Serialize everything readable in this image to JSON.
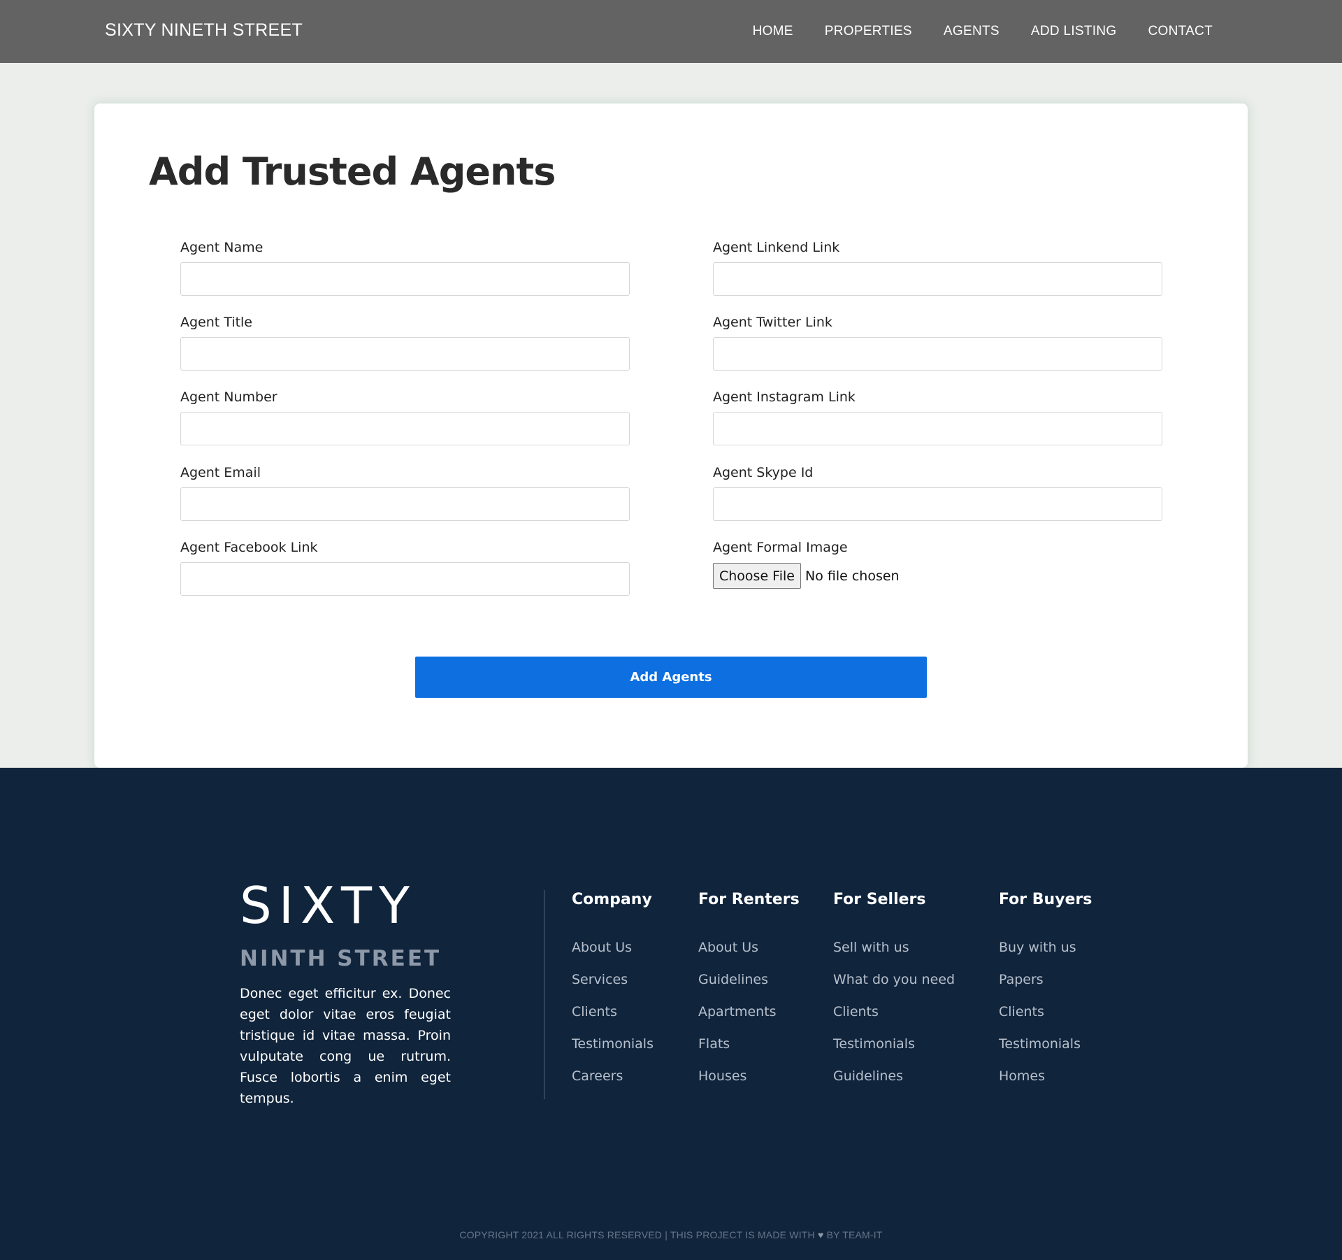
{
  "navbar": {
    "brand": "SIXTY NINETH STREET",
    "links": [
      "HOME",
      "PROPERTIES",
      "AGENTS",
      "ADD LISTING",
      "CONTACT"
    ]
  },
  "form": {
    "title": "Add Trusted Agents",
    "left_fields": [
      {
        "label": "Agent Name",
        "value": ""
      },
      {
        "label": "Agent Title",
        "value": ""
      },
      {
        "label": "Agent Number",
        "value": ""
      },
      {
        "label": "Agent Email",
        "value": ""
      },
      {
        "label": "Agent Facebook Link",
        "value": ""
      }
    ],
    "right_fields": [
      {
        "label": "Agent Linkend Link",
        "value": ""
      },
      {
        "label": "Agent Twitter Link",
        "value": ""
      },
      {
        "label": "Agent Instagram Link",
        "value": ""
      },
      {
        "label": "Agent Skype Id",
        "value": ""
      }
    ],
    "file_field": {
      "label": "Agent Formal Image",
      "button_label": "Choose File",
      "status": "No file chosen"
    },
    "submit_label": "Add Agents"
  },
  "footer": {
    "logo_main": "SIXTY",
    "logo_sub": "NINTH STREET",
    "description": "Donec eget efficitur ex. Donec eget dolor vitae eros feugiat tristique id vitae massa. Proin vulputate cong ue rutrum. Fusce lobortis a enim eget tempus.",
    "columns": [
      {
        "title": "Company",
        "links": [
          "About Us",
          "Services",
          "Clients",
          "Testimonials",
          "Careers"
        ]
      },
      {
        "title": "For Renters",
        "links": [
          "About Us",
          "Guidelines",
          "Apartments",
          "Flats",
          "Houses"
        ]
      },
      {
        "title": "For Sellers",
        "links": [
          "Sell with us",
          "What do you need",
          "Clients",
          "Testimonials",
          "Guidelines"
        ]
      },
      {
        "title": "For Buyers",
        "links": [
          "Buy with us",
          "Papers",
          "Clients",
          "Testimonials",
          "Homes"
        ]
      }
    ],
    "copyright_before": "COPYRIGHT 2021 ALL RIGHTS RESERVED | THIS PROJECT IS MADE WITH",
    "copyright_icon": "heart-icon",
    "copyright_after": "BY TEAM-IT"
  },
  "colors": {
    "navbar_bg": "#636363",
    "page_bg": "#ebeeea",
    "accent_button": "#0d6fe0",
    "footer_bg": "#10243c"
  }
}
